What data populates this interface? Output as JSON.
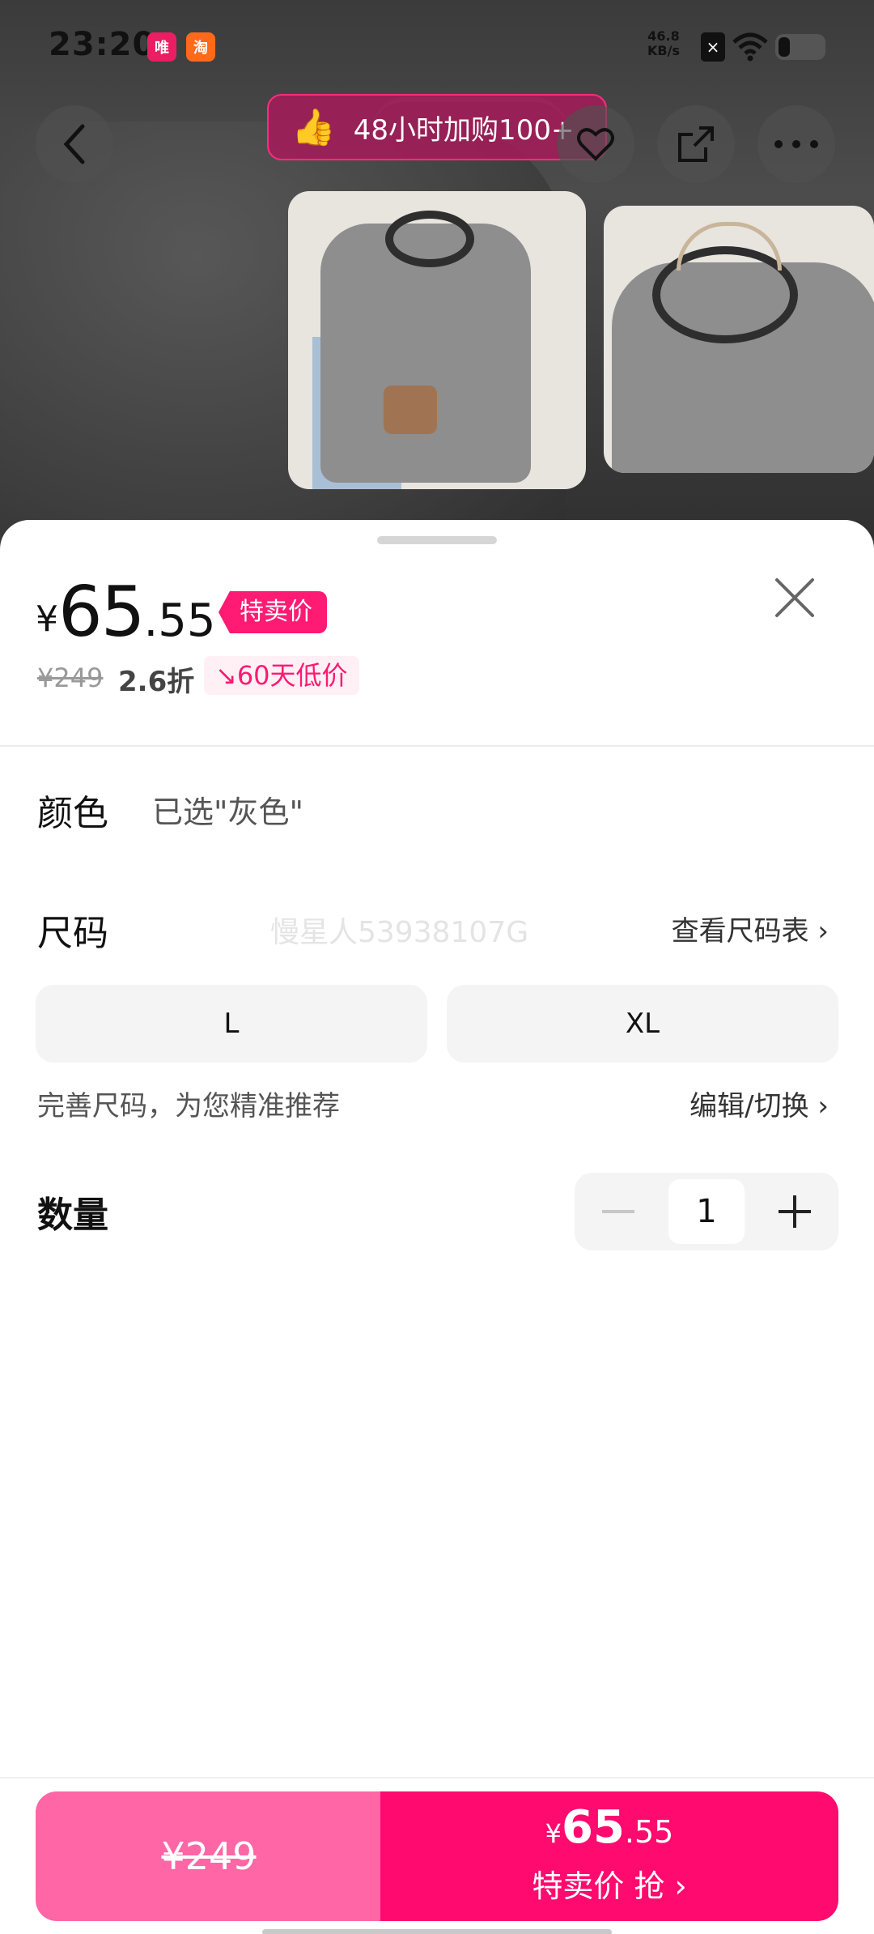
{
  "status_bar": {
    "time": "23:20",
    "net_speed": "46.8",
    "net_unit": "KB/s",
    "app_icon_1": "唯品会",
    "app_icon_2": "淘"
  },
  "promo": {
    "icon": "thumbs-up-icon",
    "text": "48小时加购100+"
  },
  "sheet": {
    "price": {
      "currency": "¥",
      "integer": "65",
      "decimal": ".55",
      "tag": "特卖价"
    },
    "original_price": "¥249",
    "discount": "2.6折",
    "low_price_badge": "60天低价",
    "color": {
      "label": "颜色",
      "value": "已选\"灰色\""
    },
    "size": {
      "label": "尺码",
      "watermark": "慢星人53938107G",
      "chart_link": "查看尺码表",
      "options": [
        "L",
        "XL"
      ],
      "hint": "完善尺码，为您精准推荐",
      "edit_link": "编辑/切换"
    },
    "quantity": {
      "label": "数量",
      "value": "1"
    }
  },
  "bottom": {
    "left_price": "¥249",
    "right_price": {
      "currency": "¥",
      "integer": "65",
      "decimal": ".55"
    },
    "right_label": "特卖价 抢"
  },
  "colors": {
    "accent": "#ff0a6f",
    "accent_light": "#ff66a6",
    "tag": "#ff1a73"
  }
}
